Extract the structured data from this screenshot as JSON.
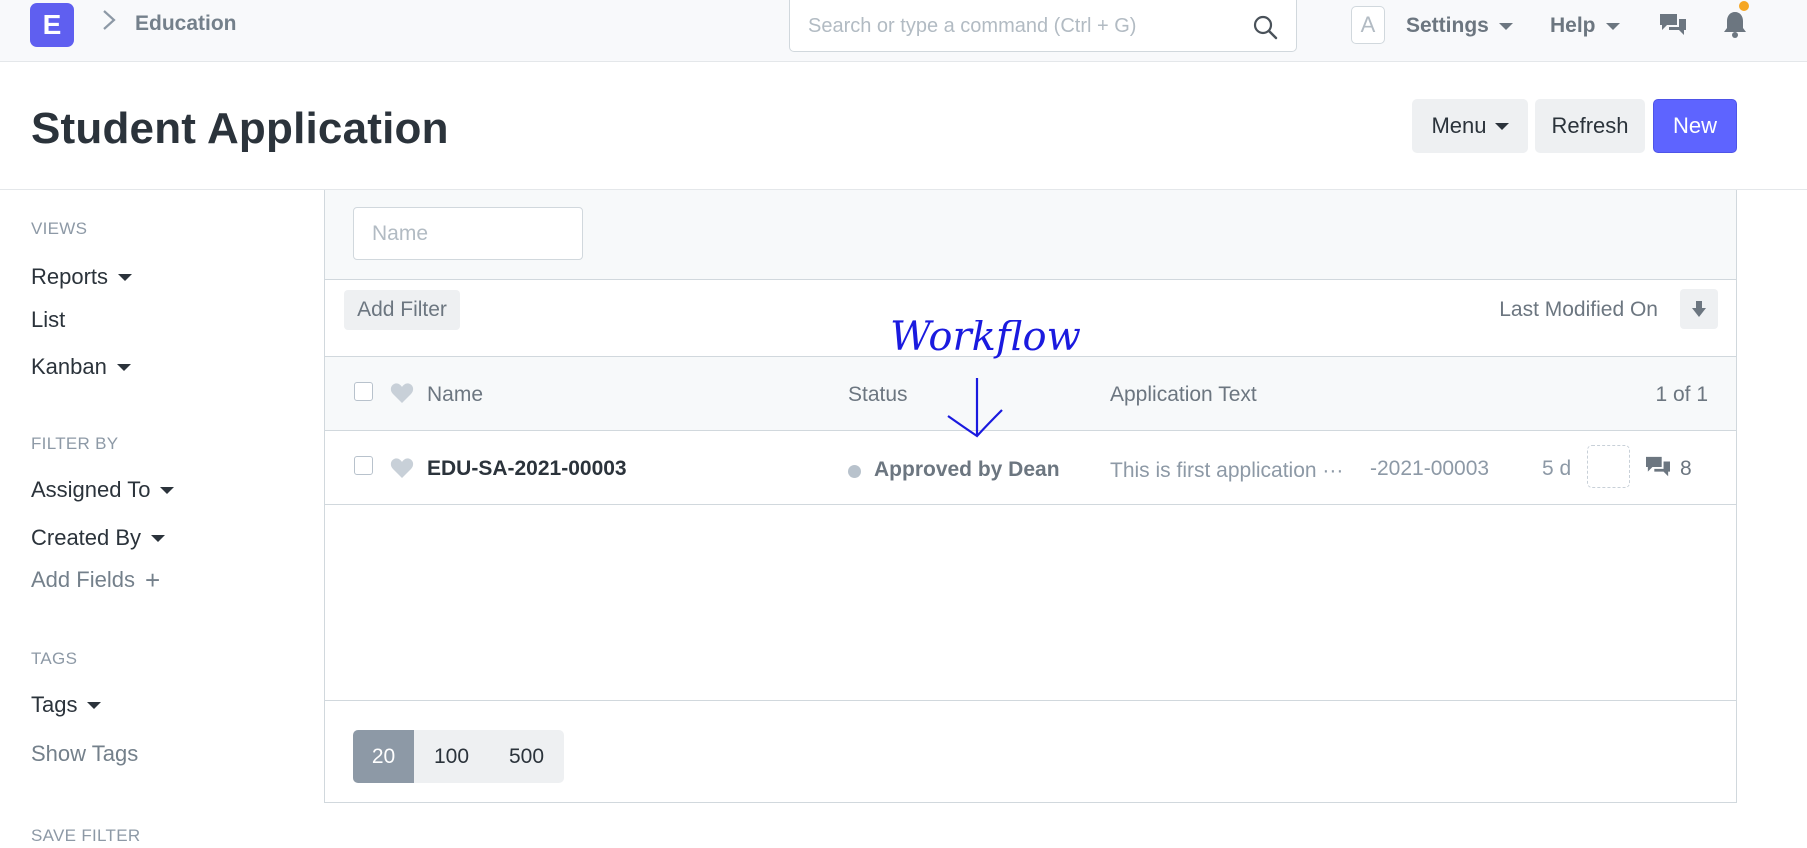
{
  "navbar": {
    "logo": "E",
    "breadcrumb": "Education",
    "search_placeholder": "Search or type a command (Ctrl + G)",
    "avatar": "A",
    "settings": "Settings",
    "help": "Help"
  },
  "page": {
    "title": "Student Application",
    "menu_label": "Menu",
    "refresh_label": "Refresh",
    "new_label": "New"
  },
  "sidebar": {
    "views_heading": "VIEWS",
    "views": [
      "Reports",
      "List",
      "Kanban"
    ],
    "filter_heading": "FILTER BY",
    "assigned_to": "Assigned To",
    "created_by": "Created By",
    "add_fields": "Add Fields",
    "tags_heading": "TAGS",
    "tags": "Tags",
    "show_tags": "Show Tags",
    "save_filter_heading": "SAVE FILTER"
  },
  "list": {
    "name_placeholder": "Name",
    "add_filter": "Add Filter",
    "sort_label": "Last Modified On",
    "columns": {
      "name": "Name",
      "status": "Status",
      "application_text": "Application Text",
      "count": "1 of 1"
    },
    "rows": [
      {
        "name": "EDU-SA-2021-00003",
        "status": "Approved by Dean",
        "application_text": "This is first application ···",
        "id_fragment": "-2021-00003",
        "modified": "5 d",
        "comments": "8"
      }
    ],
    "page_sizes": [
      "20",
      "100",
      "500"
    ]
  },
  "annotation": {
    "text": "Workflow",
    "color": "#1a1adf"
  },
  "colors": {
    "brand": "#5f5ff0",
    "primary_button": "#5e64ff",
    "notification": "#f5a623"
  }
}
